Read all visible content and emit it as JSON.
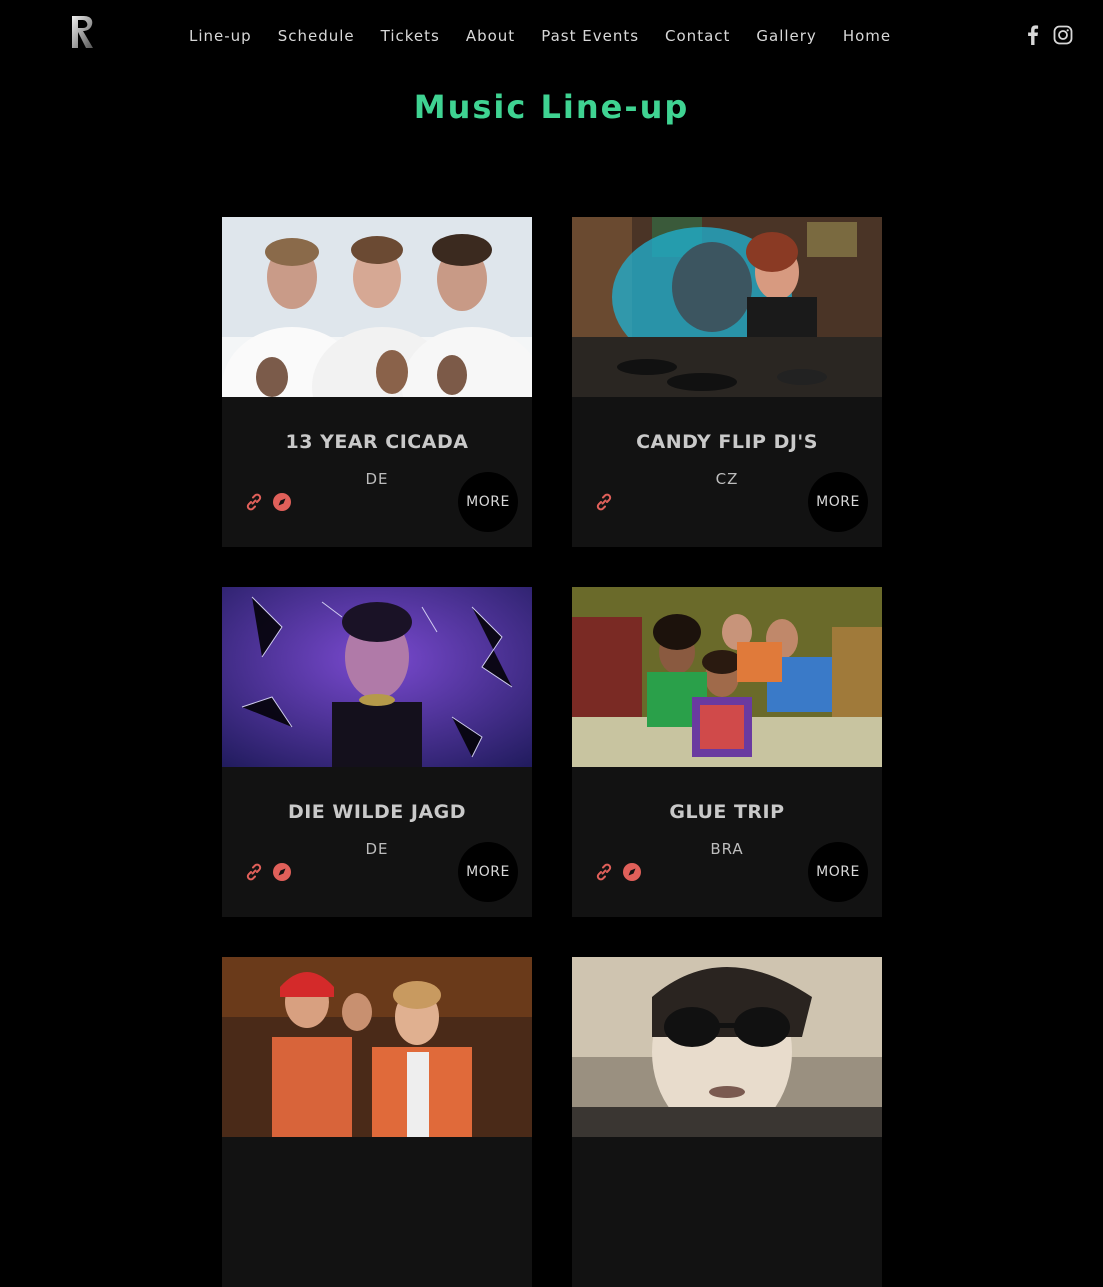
{
  "nav": {
    "items": [
      {
        "label": "Line-up"
      },
      {
        "label": "Schedule"
      },
      {
        "label": "Tickets"
      },
      {
        "label": "About"
      },
      {
        "label": "Past Events"
      },
      {
        "label": "Contact"
      },
      {
        "label": "Gallery"
      },
      {
        "label": "Home"
      }
    ]
  },
  "social": {
    "facebook_icon": "facebook-icon",
    "instagram_icon": "instagram-icon"
  },
  "page": {
    "title": "Music Line-up"
  },
  "colors": {
    "accent": "#3fd392",
    "icon": "#e0605a",
    "card_bg": "#121212"
  },
  "cards": [
    {
      "name": "13 YEAR CICADA",
      "country": "DE",
      "more_label": "MORE",
      "icons": [
        "link-icon",
        "compass-icon"
      ]
    },
    {
      "name": "CANDY FLIP DJ'S",
      "country": "CZ",
      "more_label": "MORE",
      "icons": [
        "link-icon"
      ]
    },
    {
      "name": "DIE WILDE JAGD",
      "country": "DE",
      "more_label": "MORE",
      "icons": [
        "link-icon",
        "compass-icon"
      ]
    },
    {
      "name": "GLUE TRIP",
      "country": "BRA",
      "more_label": "MORE",
      "icons": [
        "link-icon",
        "compass-icon"
      ]
    },
    {
      "name": "",
      "country": "",
      "more_label": "",
      "icons": []
    },
    {
      "name": "",
      "country": "",
      "more_label": "",
      "icons": []
    }
  ]
}
